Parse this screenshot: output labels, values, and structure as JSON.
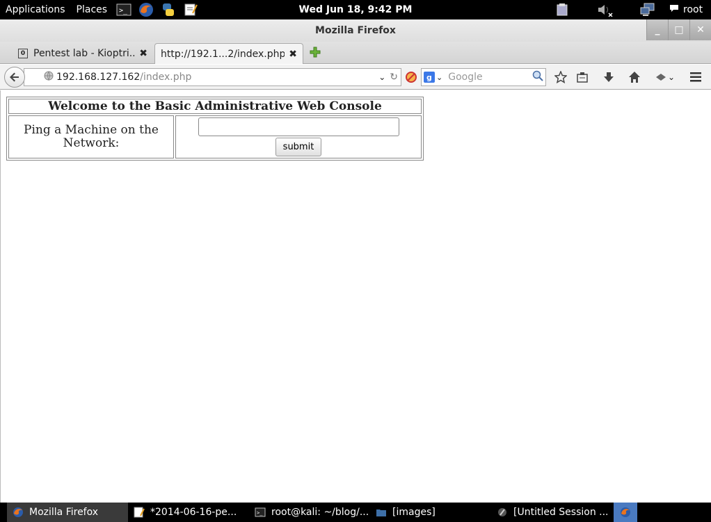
{
  "top_panel": {
    "applications": "Applications",
    "places": "Places",
    "clock": "Wed Jun 18,  9:42 PM",
    "user": "root",
    "launchers": [
      "terminal-icon",
      "firefox-icon",
      "python-icon",
      "text-editor-icon"
    ],
    "tray": [
      "clipboard-icon",
      "volume-muted-icon",
      "network-icon",
      "chat-icon"
    ]
  },
  "window": {
    "title": "Mozilla Firefox"
  },
  "tabs": [
    {
      "favicon": "0",
      "label": "Pentest lab - Kioptri...",
      "active": false
    },
    {
      "label": "http://192.1...2/index.php",
      "active": true
    }
  ],
  "navbar": {
    "url_host": "192.168.127.162",
    "url_path": "/index.php",
    "search_engine": "Google",
    "search_placeholder": "Google"
  },
  "page": {
    "title": "Welcome to the Basic Administrative Web Console",
    "ping_label": "Ping a Machine on the Network:",
    "ping_input_value": "",
    "submit_label": "submit"
  },
  "taskbar": [
    {
      "label": "Mozilla Firefox",
      "icon": "firefox-icon",
      "active": true
    },
    {
      "label": "*2014-06-16-pe...",
      "icon": "text-editor-icon",
      "active": false
    },
    {
      "label": "root@kali: ~/blog/...",
      "icon": "terminal-icon",
      "active": false
    },
    {
      "label": "[images]",
      "icon": "folder-icon",
      "active": false
    },
    {
      "label": "[Untitled Session ...",
      "icon": "app-icon",
      "active": false
    }
  ]
}
